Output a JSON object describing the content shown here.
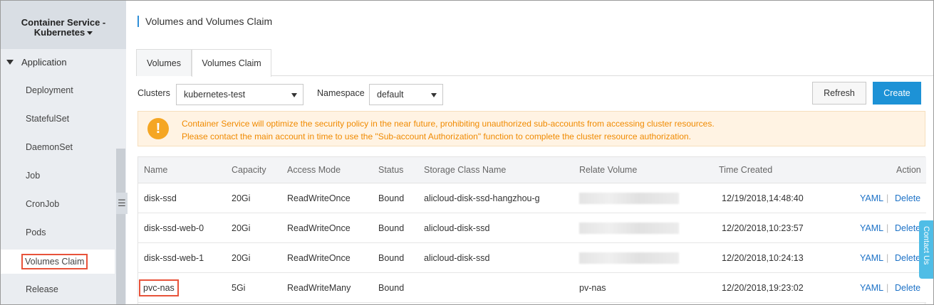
{
  "app": {
    "title": "Container Service - Kubernetes"
  },
  "sidebar": {
    "group": "Application",
    "items": [
      {
        "label": "Deployment"
      },
      {
        "label": "StatefulSet"
      },
      {
        "label": "DaemonSet"
      },
      {
        "label": "Job"
      },
      {
        "label": "CronJob"
      },
      {
        "label": "Pods"
      },
      {
        "label": "Volumes Claim",
        "active": true
      },
      {
        "label": "Release"
      }
    ],
    "collapse_icon": "collapse-menu-icon"
  },
  "page": {
    "title": "Volumes and Volumes Claim"
  },
  "tabs": [
    {
      "label": "Volumes"
    },
    {
      "label": "Volumes Claim",
      "active": true
    }
  ],
  "filters": {
    "clusters_label": "Clusters",
    "clusters_value": "kubernetes-test",
    "namespace_label": "Namespace",
    "namespace_value": "default"
  },
  "actions": {
    "refresh": "Refresh",
    "create": "Create"
  },
  "notice": {
    "line1": "Container Service will optimize the security policy in the near future, prohibiting unauthorized sub-accounts from accessing cluster resources.",
    "line2": "Please contact the main account in time to use the \"Sub-account Authorization\" function to complete the cluster resource authorization.",
    "color": "#f08a00"
  },
  "table": {
    "headers": [
      "Name",
      "Capacity",
      "Access Mode",
      "Status",
      "Storage Class Name",
      "Relate Volume",
      "Time Created",
      "Action"
    ],
    "rows": [
      {
        "name": "disk-ssd",
        "capacity": "20Gi",
        "access": "ReadWriteOnce",
        "status": "Bound",
        "storage_class": "alicloud-disk-ssd-hangzhou-g",
        "volume": "",
        "created": "12/19/2018,14:48:40",
        "yaml": "YAML",
        "sep": "|",
        "delete": "Delete"
      },
      {
        "name": "disk-ssd-web-0",
        "capacity": "20Gi",
        "access": "ReadWriteOnce",
        "status": "Bound",
        "storage_class": "alicloud-disk-ssd",
        "volume": "",
        "created": "12/20/2018,10:23:57",
        "yaml": "YAML",
        "sep": "|",
        "delete": "Delete"
      },
      {
        "name": "disk-ssd-web-1",
        "capacity": "20Gi",
        "access": "ReadWriteOnce",
        "status": "Bound",
        "storage_class": "alicloud-disk-ssd",
        "volume": "",
        "created": "12/20/2018,10:24:13",
        "yaml": "YAML",
        "sep": "|",
        "delete": "Delete"
      },
      {
        "name": "pvc-nas",
        "capacity": "5Gi",
        "access": "ReadWriteMany",
        "status": "Bound",
        "storage_class": "",
        "volume": "pv-nas",
        "created": "12/20/2018,19:23:02",
        "yaml": "YAML",
        "sep": "|",
        "delete": "Delete"
      }
    ]
  },
  "contact": {
    "label": "Contact Us"
  },
  "colors": {
    "accent": "#1d92d6",
    "link": "#1d72c7",
    "highlight": "#e8533a"
  }
}
